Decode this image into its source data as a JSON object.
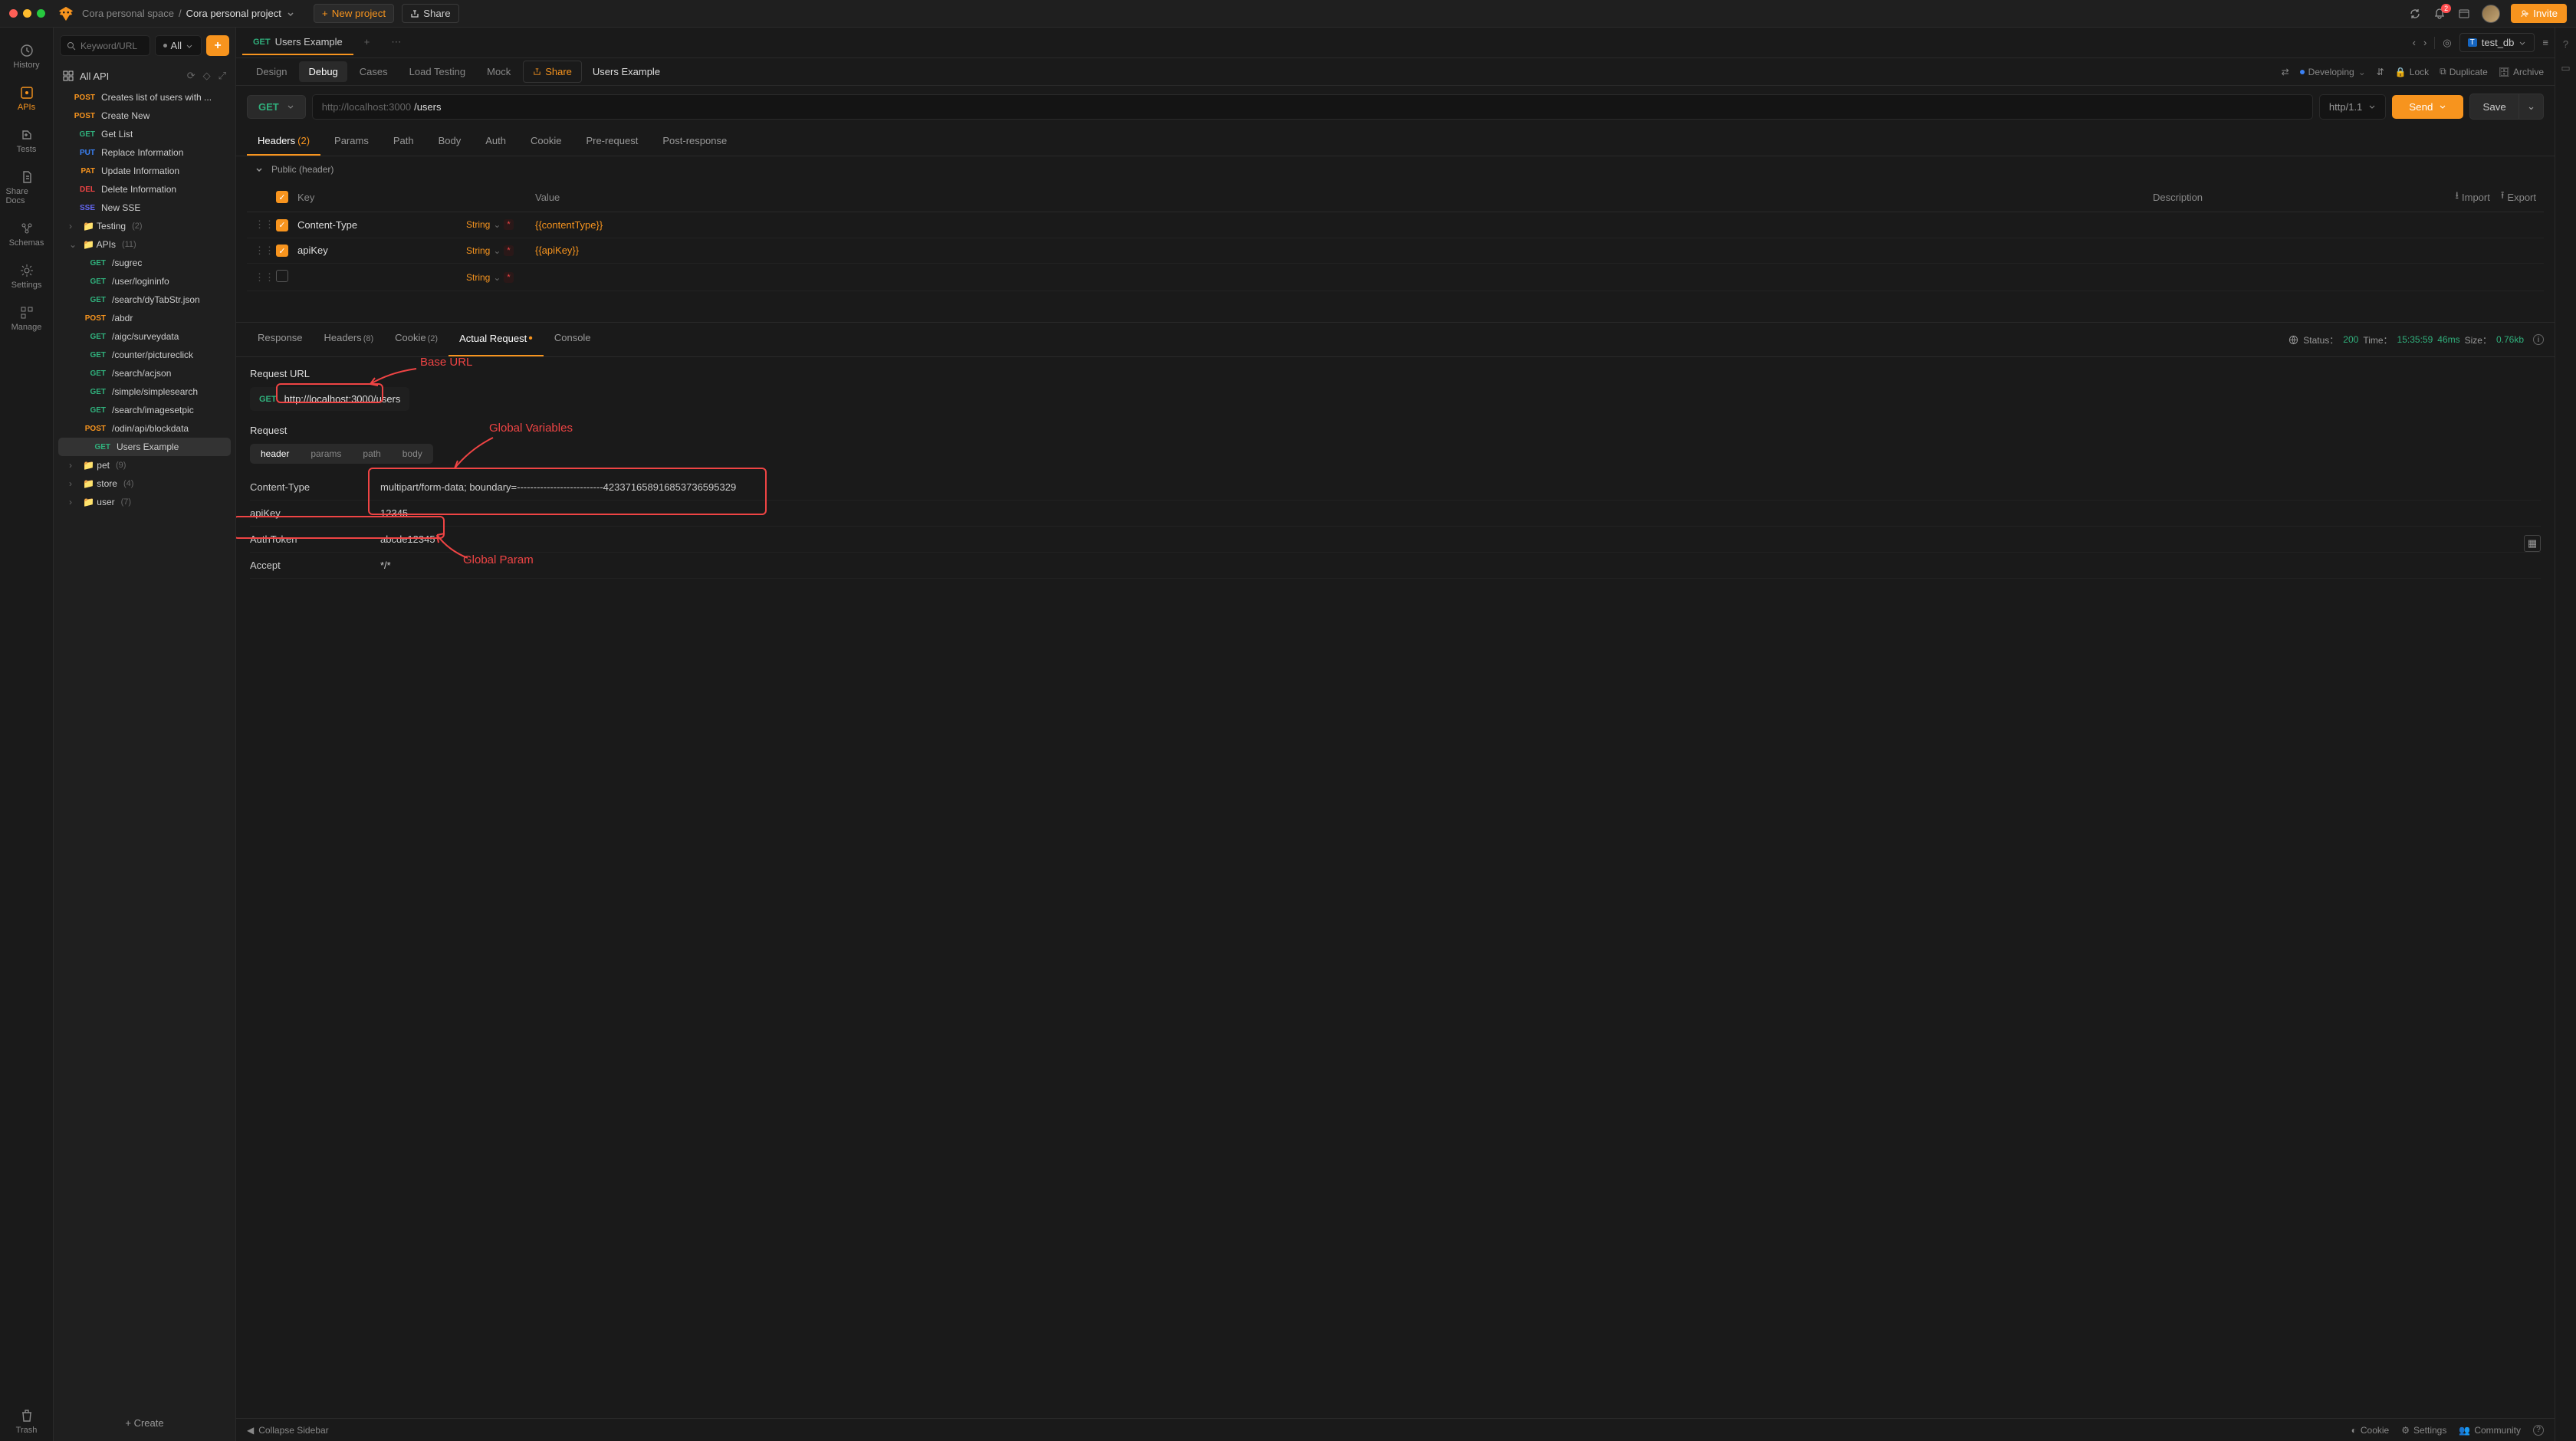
{
  "breadcrumb": {
    "space": "Cora personal space",
    "project": "Cora personal project"
  },
  "topbar": {
    "new_project": "New project",
    "share": "Share",
    "invite": "Invite",
    "notif_count": "2"
  },
  "leftnav": [
    "History",
    "APIs",
    "Tests",
    "Share Docs",
    "Schemas",
    "Settings",
    "Manage",
    "Trash"
  ],
  "sidebar": {
    "search_placeholder": "Keyword/URL",
    "filter": "All",
    "all_api": "All API",
    "create": "+  Create",
    "items": [
      {
        "method": "POST",
        "label": "Creates list of users with ..."
      },
      {
        "method": "POST",
        "label": "Create New"
      },
      {
        "method": "GET",
        "label": "Get List"
      },
      {
        "method": "PUT",
        "label": "Replace Information"
      },
      {
        "method": "PAT",
        "label": "Update Information"
      },
      {
        "method": "DEL",
        "label": "Delete Information"
      },
      {
        "method": "SSE",
        "label": "New SSE"
      }
    ],
    "folders": [
      {
        "name": "Testing",
        "count": "(2)",
        "open": false
      },
      {
        "name": "APIs",
        "count": "(11)",
        "open": true,
        "children": [
          {
            "method": "GET",
            "label": "/sugrec"
          },
          {
            "method": "GET",
            "label": "/user/logininfo"
          },
          {
            "method": "GET",
            "label": "/search/dyTabStr.json"
          },
          {
            "method": "POST",
            "label": "/abdr"
          },
          {
            "method": "GET",
            "label": "/aigc/surveydata"
          },
          {
            "method": "GET",
            "label": "/counter/pictureclick"
          },
          {
            "method": "GET",
            "label": "/search/acjson"
          },
          {
            "method": "GET",
            "label": "/simple/simplesearch"
          },
          {
            "method": "GET",
            "label": "/search/imagesetpic"
          },
          {
            "method": "POST",
            "label": "/odin/api/blockdata"
          },
          {
            "method": "GET",
            "label": "Users Example",
            "selected": true
          }
        ]
      },
      {
        "name": "pet",
        "count": "(9)",
        "open": false
      },
      {
        "name": "store",
        "count": "(4)",
        "open": false
      },
      {
        "name": "user",
        "count": "(7)",
        "open": false
      }
    ]
  },
  "tab": {
    "method": "GET",
    "title": "Users Example"
  },
  "env": {
    "name": "test_db"
  },
  "subtabs": {
    "items": [
      "Design",
      "Debug",
      "Cases",
      "Load Testing",
      "Mock"
    ],
    "active": "Debug",
    "share": "Share",
    "title": "Users Example",
    "right_status": "Developing",
    "right_actions": [
      "Lock",
      "Duplicate",
      "Archive"
    ]
  },
  "request": {
    "method": "GET",
    "base_placeholder": "http://localhost:3000",
    "path": "/users",
    "http_version": "http/1.1",
    "send": "Send",
    "save": "Save"
  },
  "req_tabs": [
    "Headers",
    "Params",
    "Path",
    "Body",
    "Auth",
    "Cookie",
    "Pre-request",
    "Post-response"
  ],
  "req_tabs_active": "Headers",
  "req_tabs_badge": "(2)",
  "collapse_label": "Public  (header)",
  "headers_table": {
    "cols": {
      "key": "Key",
      "value": "Value",
      "desc": "Description",
      "import": "Import",
      "export": "Export"
    },
    "rows": [
      {
        "on": true,
        "key": "Content-Type",
        "type": "String",
        "value": "{{contentType}}"
      },
      {
        "on": true,
        "key": "apiKey",
        "type": "String",
        "value": "{{apiKey}}"
      },
      {
        "on": false,
        "key": "",
        "type": "String",
        "value": ""
      }
    ]
  },
  "resp_tabs": {
    "items": [
      {
        "label": "Response"
      },
      {
        "label": "Headers",
        "badge": "(8)"
      },
      {
        "label": "Cookie",
        "badge": "(2)"
      },
      {
        "label": "Actual Request",
        "dot": true,
        "active": true
      },
      {
        "label": "Console"
      }
    ],
    "status_label": "Status：",
    "status_code": "200",
    "time_label": "Time：",
    "time_val": "15:35:59",
    "latency": "46ms",
    "size_label": "Size：",
    "size_val": "0.76kb"
  },
  "actual_request": {
    "url_label": "Request URL",
    "method": "GET",
    "url": "http://localhost:3000/users",
    "section_label": "Request",
    "section_tabs": [
      "header",
      "params",
      "path",
      "body"
    ],
    "section_active": "header",
    "headers": [
      {
        "k": "Content-Type",
        "v": "multipart/form-data; boundary=--------------------------423371658916853736595329"
      },
      {
        "k": "apiKey",
        "v": "12345"
      },
      {
        "k": "AuthToken",
        "v": "abcde12345"
      },
      {
        "k": "Accept",
        "v": "*/*"
      }
    ]
  },
  "annotations": {
    "base_url": "Base URL",
    "global_vars": "Global Variables",
    "global_param": "Global Param"
  },
  "footer": {
    "collapse": "Collapse Sidebar",
    "cookie": "Cookie",
    "settings": "Settings",
    "community": "Community"
  }
}
